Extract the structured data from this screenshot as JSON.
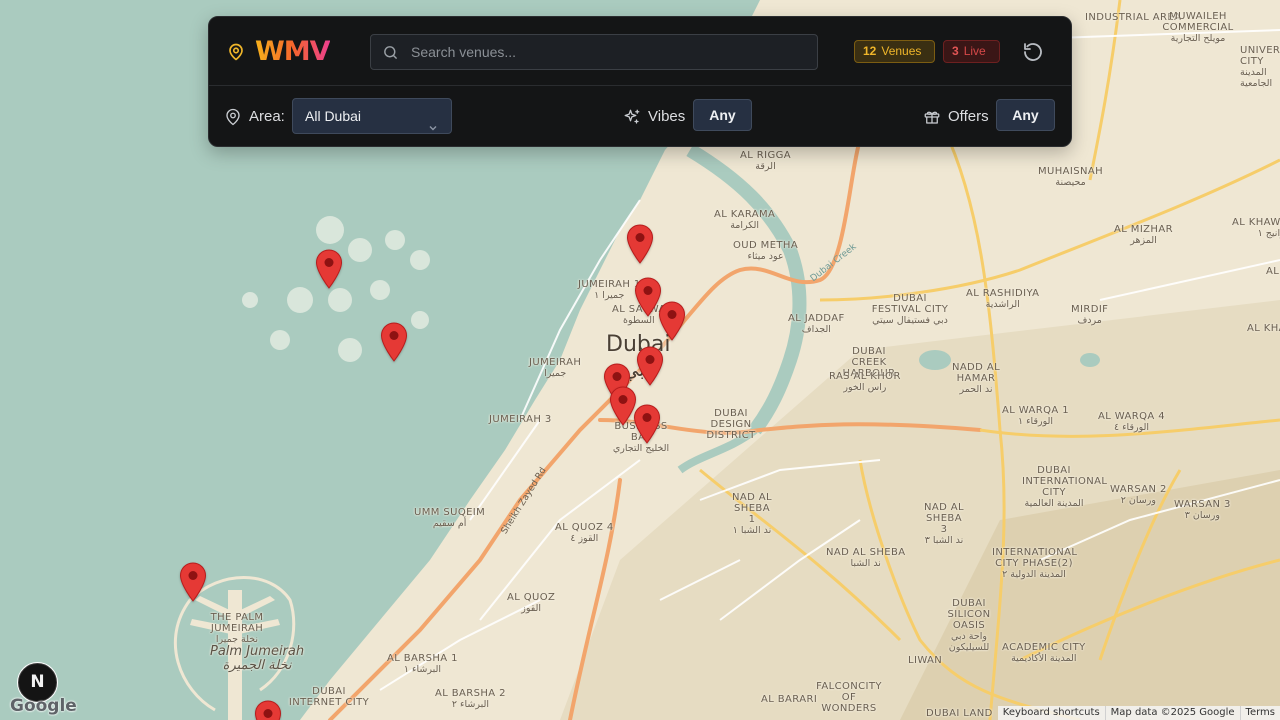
{
  "app": {
    "brand": "WMV",
    "search_placeholder": "Search venues...",
    "venue_count": "12",
    "venue_label": "Venues",
    "live_count": "3",
    "live_label": "Live"
  },
  "filters": {
    "area_label": "Area:",
    "area_value": "All Dubai",
    "vibes_label": "Vibes",
    "vibes_value": "Any",
    "offers_label": "Offers",
    "offers_value": "Any"
  },
  "map": {
    "city": {
      "name": "Dubai",
      "ar": "دبي"
    },
    "labels": [
      {
        "en": "AL RIGGA",
        "ar": "الرقة"
      },
      {
        "en": "AL KARAMA",
        "ar": "الكرامة"
      },
      {
        "en": "OUD METHA",
        "ar": "عود ميثاء"
      },
      {
        "en": "JUMEIRAH 1",
        "ar": "جميرا ١"
      },
      {
        "en": "AL SATWA",
        "ar": "السطوة"
      },
      {
        "en": "AL JADDAF",
        "ar": "الجداف"
      },
      {
        "en": "DUBAI FESTIVAL CITY",
        "ar": "دبي فستيفال سيتي"
      },
      {
        "en": "AL RASHIDIYA",
        "ar": "الراشدية"
      },
      {
        "en": "MIRDIF",
        "ar": "مردف"
      },
      {
        "en": "MUHAISNAH",
        "ar": "محيصنة"
      },
      {
        "en": "AL MIZHAR",
        "ar": "المزهر"
      },
      {
        "en": "AL KHAWANEEJ 1",
        "ar": "الخوانيج ١"
      },
      {
        "en": "JUMEIRAH",
        "ar": "جميرا"
      },
      {
        "en": "DUBAI CREEK HARBOUR",
        "ar": ""
      },
      {
        "en": "RAS AL KHOR",
        "ar": "راس الخور"
      },
      {
        "en": "NADD AL HAMAR",
        "ar": "ند الحمر"
      },
      {
        "en": "JUMEIRAH 3",
        "ar": ""
      },
      {
        "en": "BUSINESS BAY",
        "ar": "الخليج التجاري"
      },
      {
        "en": "DUBAI DESIGN DISTRICT",
        "ar": ""
      },
      {
        "en": "AL WARQA 1",
        "ar": "الورقاء ١"
      },
      {
        "en": "AL WARQA 4",
        "ar": "الورقاء ٤"
      },
      {
        "en": "DUBAI INTERNATIONAL CITY",
        "ar": "المدينة العالمية"
      },
      {
        "en": "WARSAN 2",
        "ar": "ورسان ٢"
      },
      {
        "en": "WARSAN 3",
        "ar": "ورسان ٣"
      },
      {
        "en": "UMM SUQEIM",
        "ar": "أم سقيم"
      },
      {
        "en": "AL QUOZ 4",
        "ar": "القوز ٤"
      },
      {
        "en": "NAD AL SHEBA 1",
        "ar": "ند الشبا ١"
      },
      {
        "en": "NAD AL SHEBA 3",
        "ar": "ند الشبا ٣"
      },
      {
        "en": "NAD AL SHEBA",
        "ar": "ند الشبا"
      },
      {
        "en": "INTERNATIONAL CITY PHASE(2)",
        "ar": "المدينة الدولية ٢"
      },
      {
        "en": "AL QUOZ",
        "ar": "القوز"
      },
      {
        "en": "THE PALM JUMEIRAH",
        "ar": "نخلة جميرا"
      },
      {
        "en": "DUBAI SILICON OASIS",
        "ar": "واحة دبي للسيليكون"
      },
      {
        "en": "ACADEMIC CITY",
        "ar": "المدينة الأكاديمية"
      },
      {
        "en": "LIWAN",
        "ar": ""
      },
      {
        "en": "AL BARSHA 1",
        "ar": "البرشاء ١"
      },
      {
        "en": "AL BARSHA 2",
        "ar": "البرشاء ٢"
      },
      {
        "en": "DUBAI INTERNET CITY",
        "ar": "مدينة دبي"
      },
      {
        "en": "FALCONCITY OF WONDERS",
        "ar": "فالكون سيتي"
      },
      {
        "en": "AL BARARI",
        "ar": ""
      },
      {
        "en": "DUBAI LAND",
        "ar": ""
      },
      {
        "en": "INDUSTRIAL AREA",
        "ar": ""
      },
      {
        "en": "MUWAILEH COMMERCIAL",
        "ar": "مويلح التجارية"
      },
      {
        "en": "UNIVERSITY CITY",
        "ar": "المدينة الجامعية"
      },
      {
        "en": "AL KHAWANEEJ",
        "ar": ""
      },
      {
        "en": "AL",
        "ar": ""
      }
    ],
    "palm_label": {
      "en": "Palm Jumeirah",
      "ar": "نخلة الجميرة"
    },
    "road_label": "Sheikh Zayed Rd",
    "water_label": "Dubai Creek",
    "venue_markers": 12
  },
  "footer": {
    "n_button": "N",
    "google": "Google",
    "attribution": [
      "Keyboard shortcuts",
      "Map data ©2025 Google",
      "Terms"
    ]
  },
  "colors": {
    "accent_yellow": "#f0b62a",
    "live_red": "#d64848",
    "marker_red": "#e53935",
    "panel_bg": "#141516"
  }
}
